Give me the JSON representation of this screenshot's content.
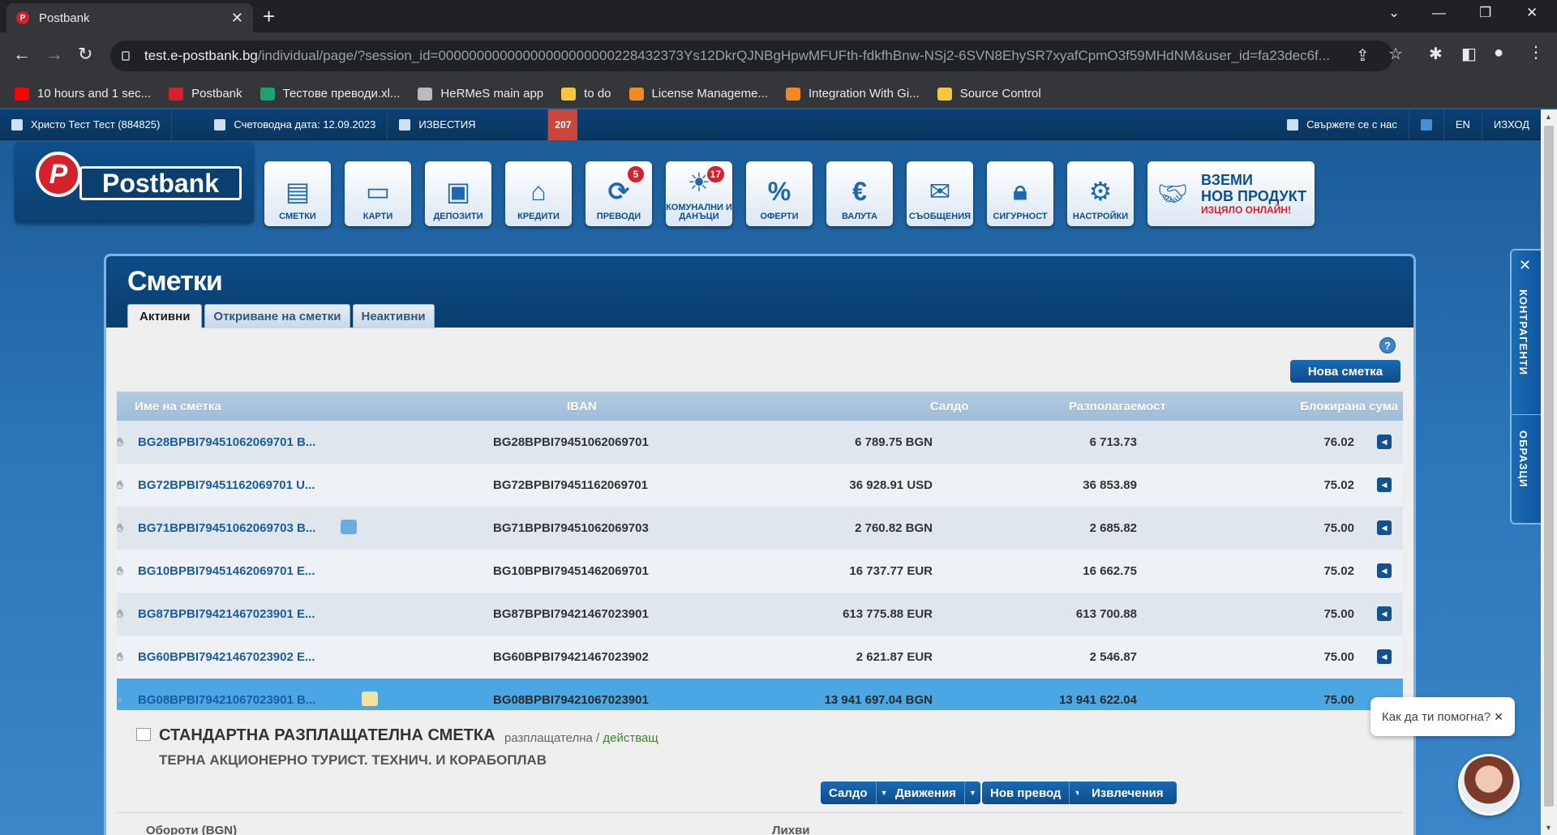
{
  "browser": {
    "tab_title": "Postbank",
    "tab_favicon": "P",
    "url_host": "test.e-postbank.bg",
    "url_rest": "/individual/page/?session_id=00000000000000000000000228432373Ys12DkrQJNBgHpwMFUFth-fdkfhBnw-NSj2-6SVN8EhySR7xyafCpmO3f59MHdNM&user_id=fa23dec6f...",
    "bookmarks": [
      {
        "label": "10 hours and 1 sec...",
        "color": "#ff0000"
      },
      {
        "label": "Postbank",
        "color": "#d4212b"
      },
      {
        "label": "Тестове преводи.xl...",
        "color": "#1aa36b"
      },
      {
        "label": "HeRMeS main app",
        "color": "#bbbbbb"
      },
      {
        "label": "to do",
        "color": "#f5c542"
      },
      {
        "label": "License Manageme...",
        "color": "#f08a24"
      },
      {
        "label": "Integration With Gi...",
        "color": "#f08a24"
      },
      {
        "label": "Source Control",
        "color": "#f5c542"
      }
    ]
  },
  "topbar": {
    "user": "Христо Тест Тест (884825)",
    "accounting_date": "Счетоводна дата: 12.09.2023",
    "news": "ИЗВЕСТИЯ",
    "news_count": "207",
    "contact": "Свържете се с нас",
    "lang": "EN",
    "logout": "ИЗХОД"
  },
  "logo": {
    "badge": "P",
    "word": "Postbank"
  },
  "menu": [
    {
      "label": "СМЕТКИ",
      "icon": "accounts-icon",
      "glyph": "▤",
      "badge": ""
    },
    {
      "label": "КАРТИ",
      "icon": "cards-icon",
      "glyph": "▭",
      "badge": ""
    },
    {
      "label": "ДЕПОЗИТИ",
      "icon": "safe-icon",
      "glyph": "▣",
      "badge": ""
    },
    {
      "label": "КРЕДИТИ",
      "icon": "house-icon",
      "glyph": "⌂",
      "badge": ""
    },
    {
      "label": "ПРЕВОДИ",
      "icon": "transfer-icon",
      "glyph": "⟳",
      "badge": "5"
    },
    {
      "label": "КОМУНАЛНИ И ДАНЪЦИ",
      "icon": "bulb-icon",
      "glyph": "☀",
      "badge": "17"
    },
    {
      "label": "ОФЕРТИ",
      "icon": "percent-icon",
      "glyph": "%",
      "badge": ""
    },
    {
      "label": "ВАЛУТА",
      "icon": "currency-icon",
      "glyph": "€",
      "badge": ""
    },
    {
      "label": "СЪОБЩЕНИЯ",
      "icon": "envelope-icon",
      "glyph": "✉",
      "badge": ""
    },
    {
      "label": "СИГУРНОСТ",
      "icon": "lock-icon",
      "glyph": "🔒︎",
      "badge": ""
    },
    {
      "label": "НАСТРОЙКИ",
      "icon": "gear-icon",
      "glyph": "⚙",
      "badge": ""
    }
  ],
  "promo": {
    "line1": "ВЗЕМИ",
    "line2": "НОВ ПРОДУКТ",
    "line3": "ИЗЦЯЛО ОНЛАЙН!"
  },
  "panel": {
    "title": "Сметки",
    "tabs": [
      "Активни",
      "Откриване на сметки",
      "Неактивни"
    ],
    "new_account_button": "Нова сметка",
    "help": "?"
  },
  "table": {
    "headers": {
      "name": "Име на сметка",
      "iban": "IBAN",
      "balance": "Салдо",
      "available": "Разполагаемост",
      "blocked": "Блокирана сума"
    },
    "rows": [
      {
        "name": "BG28BPBI79451062069701 B...",
        "iban": "BG28BPBI79451062069701",
        "balance": "6 789.75 BGN",
        "available": "6 713.73",
        "blocked": "76.02"
      },
      {
        "name": "BG72BPBI79451162069701 U...",
        "iban": "BG72BPBI79451162069701",
        "balance": "36 928.91 USD",
        "available": "36 853.89",
        "blocked": "75.02"
      },
      {
        "name": "BG71BPBI79451062069703 B...",
        "iban": "BG71BPBI79451062069703",
        "balance": "2 760.82 BGN",
        "available": "2 685.82",
        "blocked": "75.00"
      },
      {
        "name": "BG10BPBI79451462069701 E...",
        "iban": "BG10BPBI79451462069701",
        "balance": "16 737.77 EUR",
        "available": "16 662.75",
        "blocked": "75.02"
      },
      {
        "name": "BG87BPBI79421467023901 E...",
        "iban": "BG87BPBI79421467023901",
        "balance": "613 775.88 EUR",
        "available": "613 700.88",
        "blocked": "75.00"
      },
      {
        "name": "BG60BPBI79421467023902 E...",
        "iban": "BG60BPBI79421467023902",
        "balance": "2 621.87 EUR",
        "available": "2 546.87",
        "blocked": "75.00"
      },
      {
        "name": "BG08BPBI79421067023901 B...",
        "iban": "BG08BPBI79421067023901",
        "balance": "13 941 697.04 BGN",
        "available": "13 941 622.04",
        "blocked": "75.00"
      }
    ]
  },
  "detail": {
    "title": "СТАНДАРТНА РАЗПЛАЩАТЕЛНА СМЕТКА",
    "type": "разплащателна /",
    "status": "действащ",
    "subtitle": "ТЕРНА АКЦИОНЕРНО ТУРИСТ. ТЕХНИЧ. И КОРАБОПЛАВ",
    "buttons": {
      "balance": "Салдо",
      "movements": "Движения",
      "transfer": "Нов превод",
      "statements": "Извлечения"
    },
    "foot_left": "Обороти (BGN)",
    "foot_right": "Лихви"
  },
  "side": {
    "contractors": "КОНТРАГЕНТИ",
    "templates": "ОБРАЗЦИ"
  },
  "chat": {
    "prompt": "Как да ти помогна?"
  }
}
